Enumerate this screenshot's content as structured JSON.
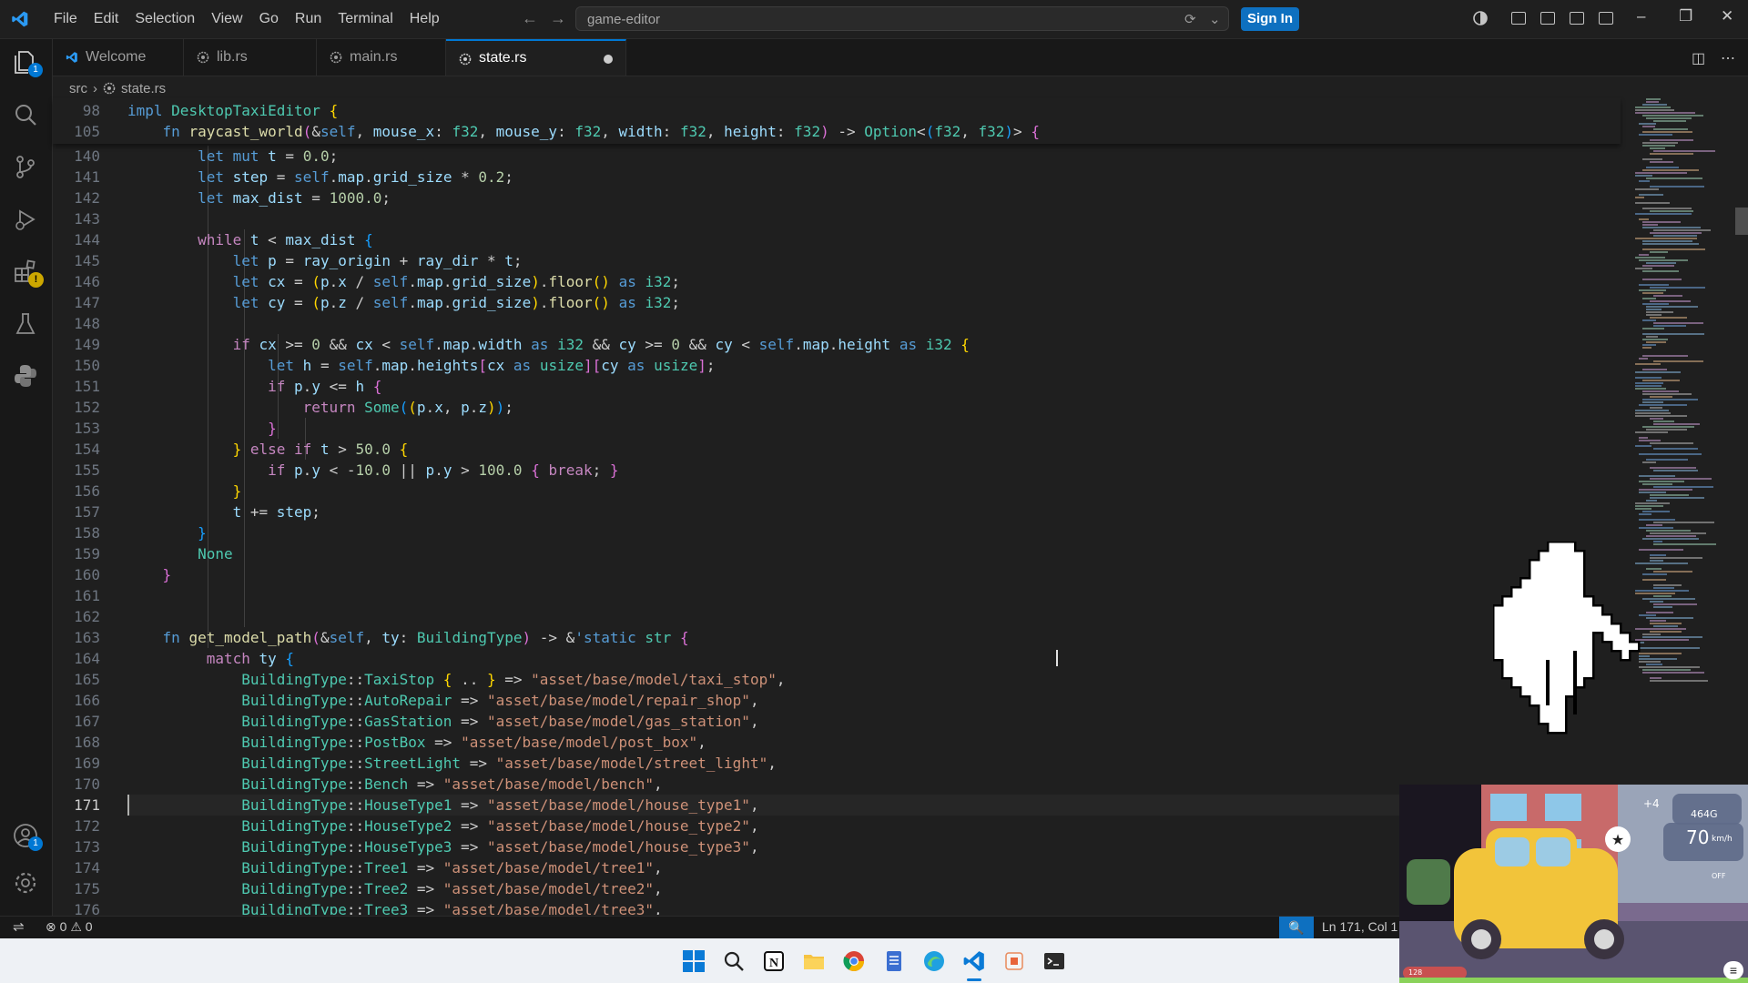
{
  "menu": [
    "File",
    "Edit",
    "Selection",
    "View",
    "Go",
    "Run",
    "Terminal",
    "Help"
  ],
  "search": {
    "text": "game-editor"
  },
  "signin_label": "Sign In",
  "activity": {
    "explorer_badge": "1",
    "accounts_badge": "1"
  },
  "tabs": [
    {
      "label": "Welcome",
      "icon": "vscode-icon"
    },
    {
      "label": "lib.rs",
      "icon": "rust-icon"
    },
    {
      "label": "main.rs",
      "icon": "rust-icon"
    },
    {
      "label": "state.rs",
      "icon": "rust-icon",
      "active": true,
      "dirty": true
    }
  ],
  "breadcrumb": {
    "folder": "src",
    "file": "state.rs"
  },
  "sticky": [
    {
      "n": "98",
      "html": "<span class='kw'>impl</span> <span class='ty'>DesktopTaxiEditor</span> <span class='bk'>{</span>"
    },
    {
      "n": "105",
      "html": "    <span class='kw'>fn</span> <span class='fn'>raycast_world</span><span class='bk2'>(</span>&amp;<span class='kw'>self</span>, <span class='vr'>mouse_x</span>: <span class='ty'>f32</span>, <span class='vr'>mouse_y</span>: <span class='ty'>f32</span>, <span class='vr'>width</span>: <span class='ty'>f32</span>, <span class='vr'>height</span>: <span class='ty'>f32</span><span class='bk2'>)</span> -&gt; <span class='ty'>Option</span>&lt;<span class='bk3'>(</span><span class='ty'>f32</span>, <span class='ty'>f32</span><span class='bk3'>)</span>&gt; <span class='bk2'>{</span>"
    }
  ],
  "lines": [
    {
      "n": "140",
      "html": "        <span class='kw'>let</span> <span class='kw'>mut</span> <span class='vr'>t</span> = <span class='nu'>0.0</span>;"
    },
    {
      "n": "141",
      "html": "        <span class='kw'>let</span> <span class='vr'>step</span> = <span class='kw'>self</span>.<span class='vr'>map</span>.<span class='vr'>grid_size</span> * <span class='nu'>0.2</span>;"
    },
    {
      "n": "142",
      "html": "        <span class='kw'>let</span> <span class='vr'>max_dist</span> = <span class='nu'>1000.0</span>;"
    },
    {
      "n": "143",
      "html": ""
    },
    {
      "n": "144",
      "html": "        <span class='ct'>while</span> <span class='vr'>t</span> &lt; <span class='vr'>max_dist</span> <span class='bk3'>{</span>"
    },
    {
      "n": "145",
      "html": "            <span class='kw'>let</span> <span class='vr'>p</span> = <span class='vr'>ray_origin</span> + <span class='vr'>ray_dir</span> * <span class='vr'>t</span>;"
    },
    {
      "n": "146",
      "html": "            <span class='kw'>let</span> <span class='vr'>cx</span> = <span class='bk'>(</span><span class='vr'>p</span>.<span class='vr'>x</span> / <span class='kw'>self</span>.<span class='vr'>map</span>.<span class='vr'>grid_size</span><span class='bk'>)</span>.<span class='fn'>floor</span><span class='bk'>()</span> <span class='kw'>as</span> <span class='ty'>i32</span>;"
    },
    {
      "n": "147",
      "html": "            <span class='kw'>let</span> <span class='vr'>cy</span> = <span class='bk'>(</span><span class='vr'>p</span>.<span class='vr'>z</span> / <span class='kw'>self</span>.<span class='vr'>map</span>.<span class='vr'>grid_size</span><span class='bk'>)</span>.<span class='fn'>floor</span><span class='bk'>()</span> <span class='kw'>as</span> <span class='ty'>i32</span>;"
    },
    {
      "n": "148",
      "html": ""
    },
    {
      "n": "149",
      "html": "            <span class='ct'>if</span> <span class='vr'>cx</span> &gt;= <span class='nu'>0</span> &amp;&amp; <span class='vr'>cx</span> &lt; <span class='kw'>self</span>.<span class='vr'>map</span>.<span class='vr'>width</span> <span class='kw'>as</span> <span class='ty'>i32</span> &amp;&amp; <span class='vr'>cy</span> &gt;= <span class='nu'>0</span> &amp;&amp; <span class='vr'>cy</span> &lt; <span class='kw'>self</span>.<span class='vr'>map</span>.<span class='vr'>height</span> <span class='kw'>as</span> <span class='ty'>i32</span> <span class='bk'>{</span>"
    },
    {
      "n": "150",
      "html": "                <span class='kw'>let</span> <span class='vr'>h</span> = <span class='kw'>self</span>.<span class='vr'>map</span>.<span class='vr'>heights</span><span class='bk2'>[</span><span class='vr'>cx</span> <span class='kw'>as</span> <span class='ty'>usize</span><span class='bk2'>][</span><span class='vr'>cy</span> <span class='kw'>as</span> <span class='ty'>usize</span><span class='bk2'>]</span>;"
    },
    {
      "n": "151",
      "html": "                <span class='ct'>if</span> <span class='vr'>p</span>.<span class='vr'>y</span> &lt;= <span class='vr'>h</span> <span class='bk2'>{</span>"
    },
    {
      "n": "152",
      "html": "                    <span class='ct'>return</span> <span class='ty'>Some</span><span class='bk3'>(</span><span class='bk'>(</span><span class='vr'>p</span>.<span class='vr'>x</span>, <span class='vr'>p</span>.<span class='vr'>z</span><span class='bk'>)</span><span class='bk3'>)</span>;"
    },
    {
      "n": "153",
      "html": "                <span class='bk2'>}</span>"
    },
    {
      "n": "154",
      "html": "            <span class='bk'>}</span> <span class='ct'>else</span> <span class='ct'>if</span> <span class='vr'>t</span> &gt; <span class='nu'>50.0</span> <span class='bk'>{</span>"
    },
    {
      "n": "155",
      "html": "                <span class='ct'>if</span> <span class='vr'>p</span>.<span class='vr'>y</span> &lt; -<span class='nu'>10.0</span> || <span class='vr'>p</span>.<span class='vr'>y</span> &gt; <span class='nu'>100.0</span> <span class='bk2'>{</span> <span class='ct'>break</span>; <span class='bk2'>}</span>"
    },
    {
      "n": "156",
      "html": "            <span class='bk'>}</span>"
    },
    {
      "n": "157",
      "html": "            <span class='vr'>t</span> += <span class='vr'>step</span>;"
    },
    {
      "n": "158",
      "html": "        <span class='bk3'>}</span>"
    },
    {
      "n": "159",
      "html": "        <span class='ty'>None</span>"
    },
    {
      "n": "160",
      "html": "    <span class='bk2'>}</span>"
    },
    {
      "n": "161",
      "html": ""
    },
    {
      "n": "162",
      "html": ""
    },
    {
      "n": "163",
      "html": "    <span class='kw'>fn</span> <span class='fn'>get_model_path</span><span class='bk2'>(</span>&amp;<span class='kw'>self</span>, <span class='vr'>ty</span>: <span class='ty'>BuildingType</span><span class='bk2'>)</span> -&gt; &amp;<span class='kw'>'static</span> <span class='ty'>str</span> <span class='bk2'>{</span>"
    },
    {
      "n": "164",
      "html": "         <span class='ct'>match</span> <span class='vr'>ty</span> <span class='bk3'>{</span>"
    },
    {
      "n": "165",
      "html": "             <span class='ty'>BuildingType</span>::<span class='ty'>TaxiStop</span> <span class='bk'>{</span> .. <span class='bk'>}</span> =&gt; <span class='st'>\"asset/base/model/taxi_stop\"</span>,"
    },
    {
      "n": "166",
      "html": "             <span class='ty'>BuildingType</span>::<span class='ty'>AutoRepair</span> =&gt; <span class='st'>\"asset/base/model/repair_shop\"</span>,"
    },
    {
      "n": "167",
      "html": "             <span class='ty'>BuildingType</span>::<span class='ty'>GasStation</span> =&gt; <span class='st'>\"asset/base/model/gas_station\"</span>,"
    },
    {
      "n": "168",
      "html": "             <span class='ty'>BuildingType</span>::<span class='ty'>PostBox</span> =&gt; <span class='st'>\"asset/base/model/post_box\"</span>,"
    },
    {
      "n": "169",
      "html": "             <span class='ty'>BuildingType</span>::<span class='ty'>StreetLight</span> =&gt; <span class='st'>\"asset/base/model/street_light\"</span>,"
    },
    {
      "n": "170",
      "html": "             <span class='ty'>BuildingType</span>::<span class='ty'>Bench</span> =&gt; <span class='st'>\"asset/base/model/bench\"</span>,"
    },
    {
      "n": "171",
      "html": "             <span class='ty'>BuildingType</span>::<span class='ty'>HouseType1</span> =&gt; <span class='st'>\"asset/base/model/house_type1\"</span>,",
      "current": true
    },
    {
      "n": "172",
      "html": "             <span class='ty'>BuildingType</span>::<span class='ty'>HouseType2</span> =&gt; <span class='st'>\"asset/base/model/house_type2\"</span>,"
    },
    {
      "n": "173",
      "html": "             <span class='ty'>BuildingType</span>::<span class='ty'>HouseType3</span> =&gt; <span class='st'>\"asset/base/model/house_type3\"</span>,"
    },
    {
      "n": "174",
      "html": "             <span class='ty'>BuildingType</span>::<span class='ty'>Tree1</span> =&gt; <span class='st'>\"asset/base/model/tree1\"</span>,"
    },
    {
      "n": "175",
      "html": "             <span class='ty'>BuildingType</span>::<span class='ty'>Tree2</span> =&gt; <span class='st'>\"asset/base/model/tree2\"</span>,"
    },
    {
      "n": "176",
      "html": "             <span class='ty'>BuildingType</span>::<span class='ty'>Tree3</span> =&gt; <span class='st'>\"asset/base/model/tree3\"</span>,"
    }
  ],
  "status": {
    "errors": "0",
    "warnings": "0",
    "position": "Ln 171, Col 1"
  },
  "game": {
    "tip": "+4",
    "money": "464G",
    "speed": "70",
    "speed_unit": "km/h",
    "toggle": "OFF",
    "fuel": "128"
  },
  "colors": {
    "accent": "#0078d4",
    "signin": "#0e70c0",
    "taxi": "#f2c43a"
  }
}
